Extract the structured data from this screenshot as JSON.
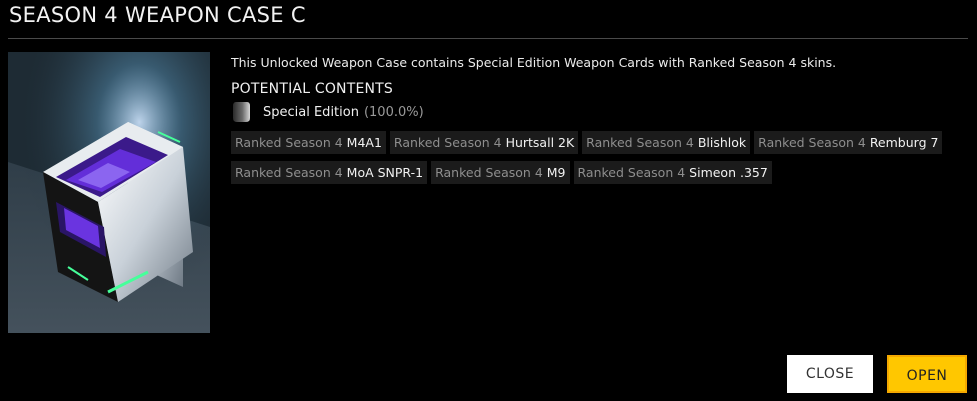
{
  "dialog": {
    "title": "SEASON 4 WEAPON CASE C",
    "description": "This Unlocked Weapon Case contains Special Edition Weapon Cards with Ranked Season 4 skins.",
    "contents_heading": "POTENTIAL CONTENTS",
    "edition": {
      "label": "Special Edition",
      "percent": "(100.0%)",
      "icon": "special-edition-badge-icon"
    },
    "chip_rows": [
      [
        {
          "prefix": "Ranked Season 4",
          "name": "M4A1"
        },
        {
          "prefix": "Ranked Season 4",
          "name": "Hurtsall 2K"
        },
        {
          "prefix": "Ranked Season 4",
          "name": "Blishlok"
        },
        {
          "prefix": "Ranked Season 4",
          "name": "Remburg 7"
        }
      ],
      [
        {
          "prefix": "Ranked Season 4",
          "name": "MoA SNPR-1"
        },
        {
          "prefix": "Ranked Season 4",
          "name": "M9"
        },
        {
          "prefix": "Ranked Season 4",
          "name": "Simeon .357"
        }
      ]
    ],
    "buttons": {
      "close": "CLOSE",
      "open": "OPEN"
    },
    "colors": {
      "background": "#000000",
      "chip_bg": "#1b1b1b",
      "open_button": "#ffc700",
      "close_button": "#ffffff",
      "case_glow": "#7a3cff"
    }
  }
}
